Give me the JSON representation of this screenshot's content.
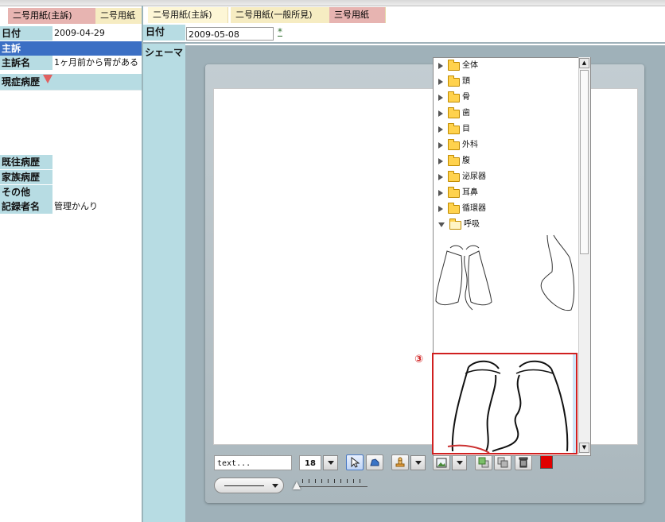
{
  "tabs_left": [
    "二号用紙(主訴)",
    "二号用紙"
  ],
  "tabs_right": [
    "二号用紙(主訴)",
    "二号用紙(一般所見)",
    "三号用紙"
  ],
  "left": {
    "date_label": "日付",
    "date_value": "2009-04-29",
    "chief_complaint_label": "主訴",
    "complaint_name_label": "主訴名",
    "complaint_name_value": "1ヶ月前から胃がある",
    "present_history_label": "現症病歴",
    "past_history_label": "既往病歴",
    "family_history_label": "家族病歴",
    "other_label": "その他",
    "recorder_label": "記録者名",
    "recorder_value": "管理かんり"
  },
  "right": {
    "date_label": "日付",
    "date_value": "2009-05-08",
    "asterisk": "*",
    "schema_label": "シェーマ"
  },
  "tree": {
    "items": [
      "全体",
      "頭",
      "骨",
      "歯",
      "目",
      "外科",
      "腹",
      "泌尿器",
      "耳鼻",
      "循環器",
      "呼吸"
    ],
    "expanded": "呼吸",
    "selected_marker": "③"
  },
  "toolbar": {
    "text_placeholder": "text...",
    "font_size": "18",
    "color": "#e00000"
  },
  "colors": {
    "label_bg": "#b7dce3",
    "active_label_bg": "#3b6fc4",
    "tab_pink": "#e7b4b1",
    "tab_yellow": "#f6ecc2",
    "panel_gray": "#9fb1b9",
    "selection_red": "#d02020"
  }
}
